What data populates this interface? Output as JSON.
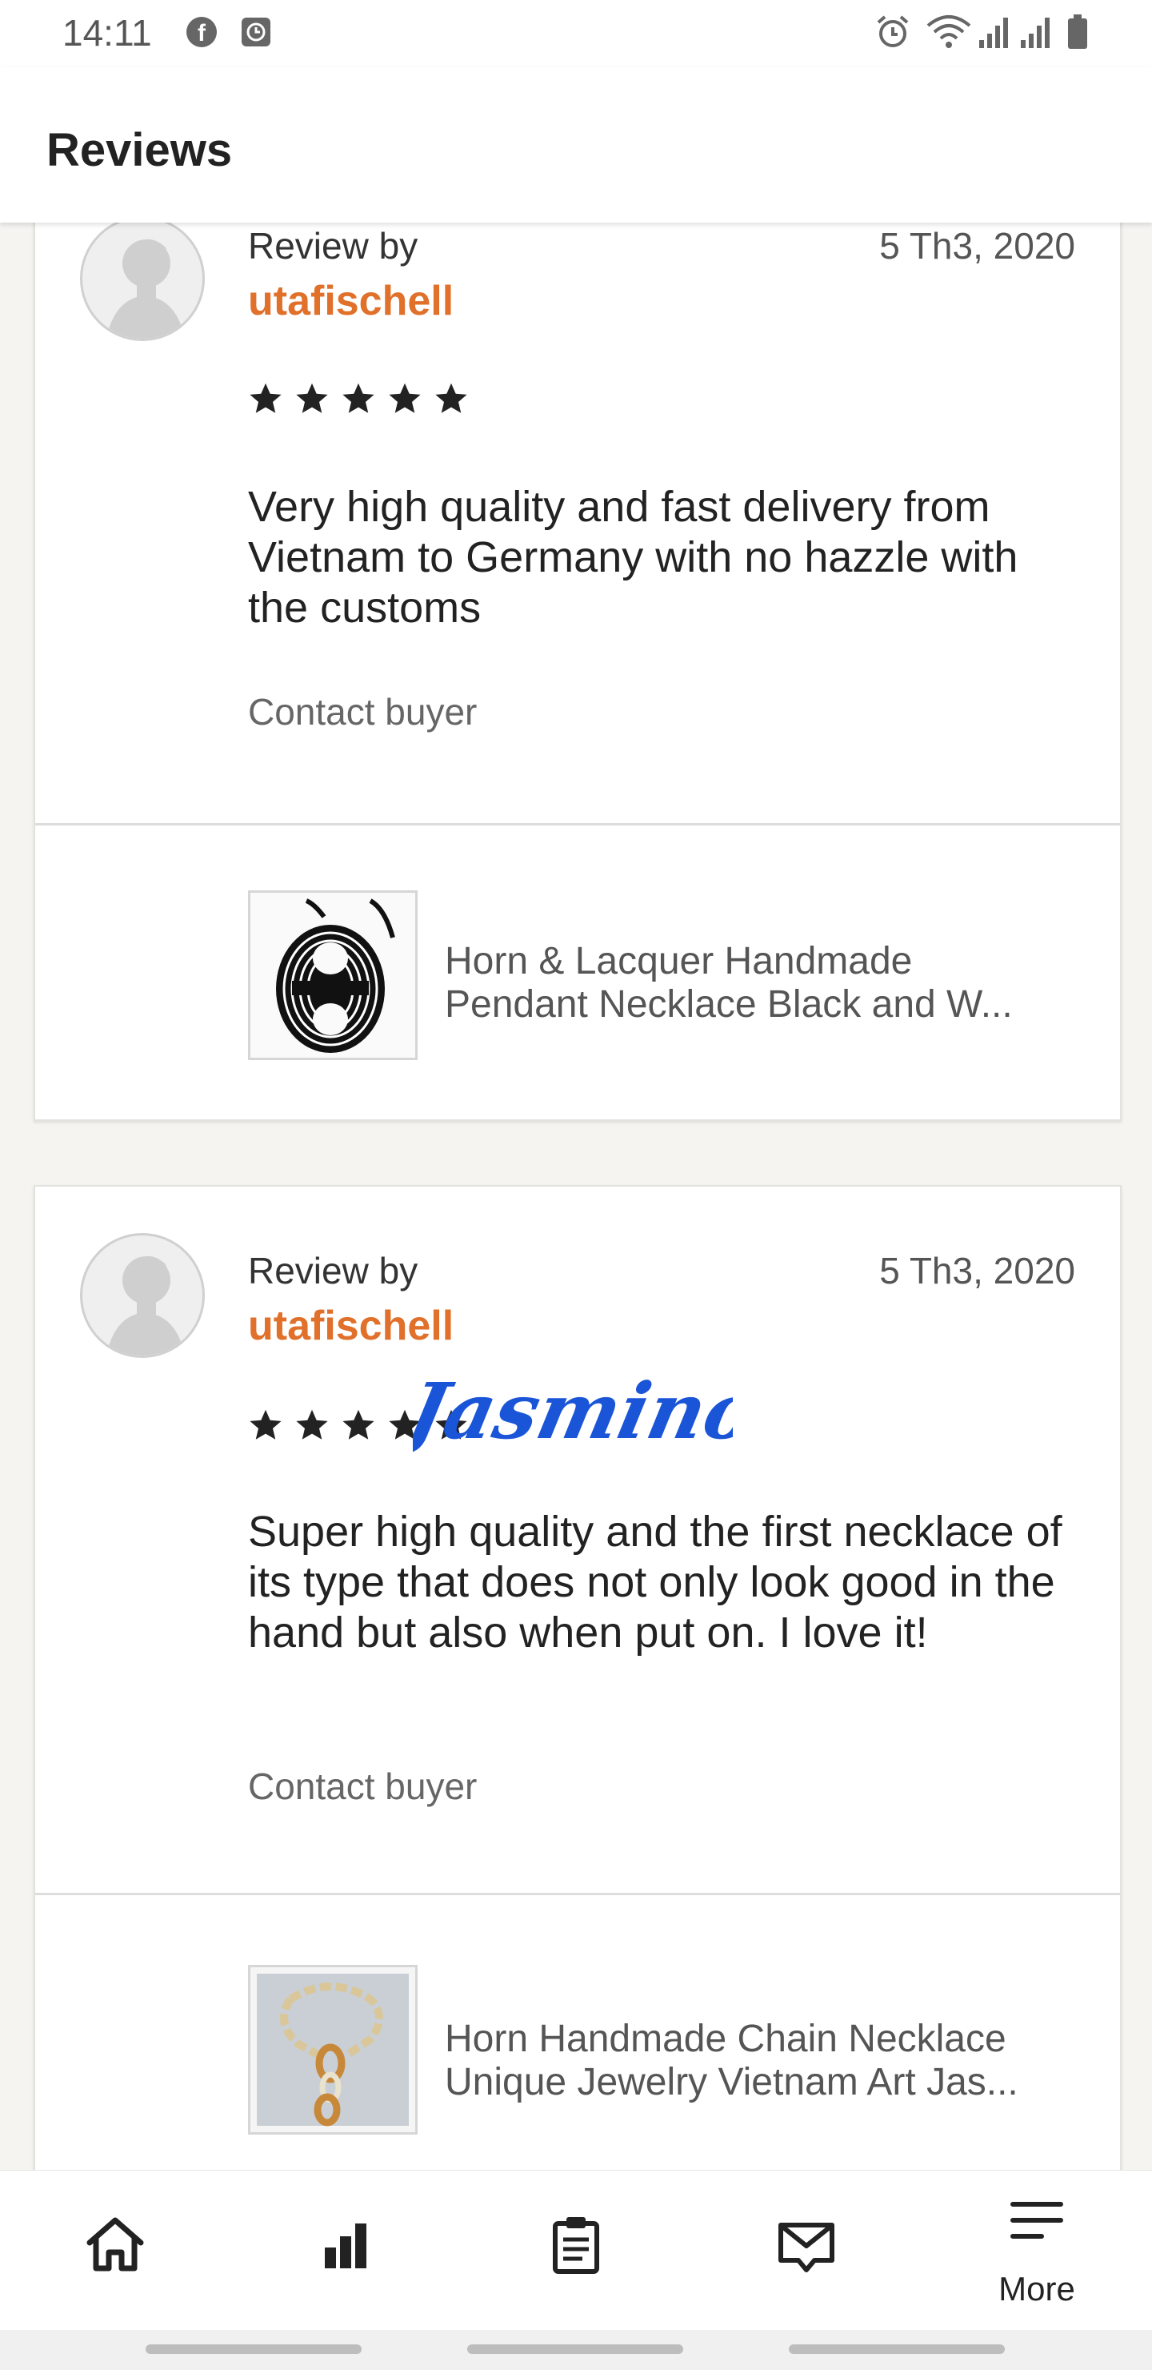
{
  "status_bar": {
    "time": "14:11",
    "left_icons": [
      "facebook-icon",
      "clock-app-icon"
    ],
    "right_icons": [
      "alarm-icon",
      "wifi-icon",
      "signal-icon",
      "signal-icon",
      "battery-icon"
    ]
  },
  "header": {
    "title": "Reviews"
  },
  "reviews": [
    {
      "review_by_label": "Review by",
      "date": "5 Th3, 2020",
      "username": "utafischell",
      "rating": 5,
      "text": "Very high quality and fast delivery from Vietnam to Germany with no hazzle with the customs",
      "contact_label": "Contact buyer",
      "product": {
        "title_line1": "Horn & Lacquer Handmade",
        "title_line2": "Pendant Necklace Black and W..."
      }
    },
    {
      "review_by_label": "Review by",
      "date": "5 Th3, 2020",
      "username": "utafischell",
      "rating": 5,
      "text": "Super high quality and the first necklace of its type that does not only look good in the hand but also when put on. I love it!",
      "contact_label": "Contact buyer",
      "product": {
        "title_line1": "Horn Handmade Chain Necklace",
        "title_line2": "Unique Jewelry Vietnam Art Jas..."
      }
    }
  ],
  "watermark": "Jasmino",
  "bottom_nav": [
    {
      "icon": "home-icon",
      "label": ""
    },
    {
      "icon": "stats-icon",
      "label": ""
    },
    {
      "icon": "orders-icon",
      "label": ""
    },
    {
      "icon": "messages-icon",
      "label": ""
    },
    {
      "icon": "menu-icon",
      "label": "More"
    }
  ],
  "colors": {
    "username": "#e0702a",
    "watermark": "#1a55d8",
    "background": "#f5f4f1"
  }
}
